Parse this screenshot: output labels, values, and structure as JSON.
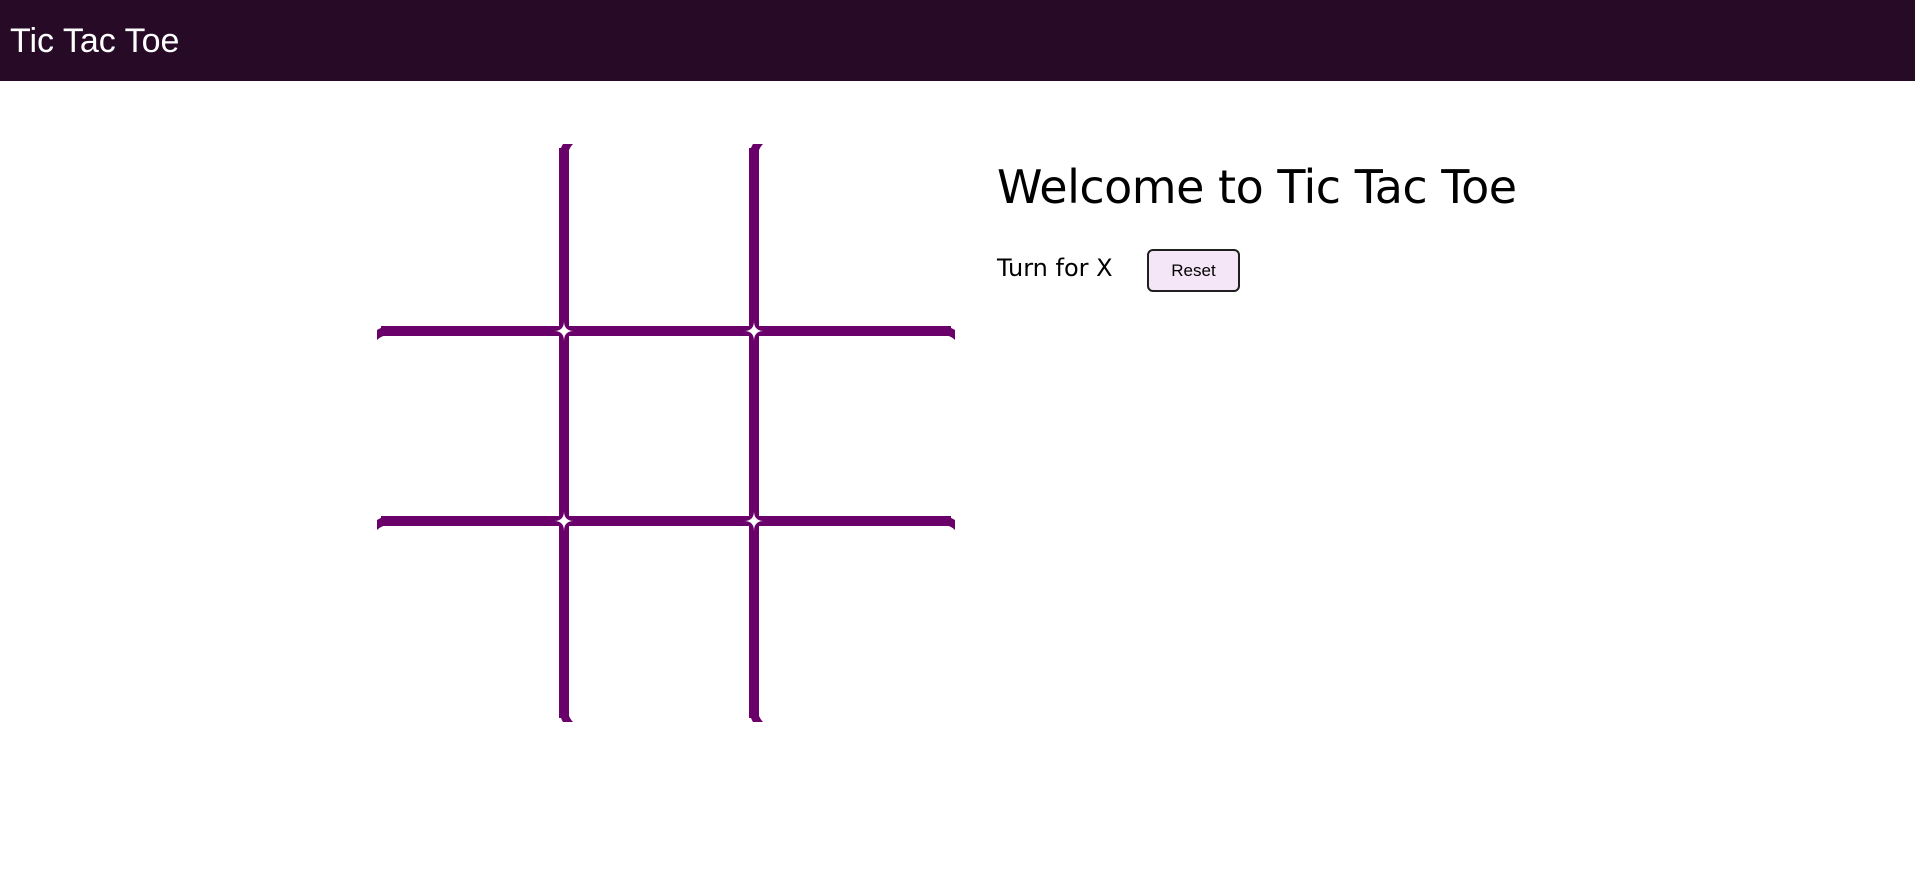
{
  "header": {
    "title": "Tic Tac Toe"
  },
  "game": {
    "heading": "Welcome to Tic Tac Toe",
    "turn_text": "Turn for X",
    "reset_label": "Reset",
    "board": [
      [
        "",
        "",
        ""
      ],
      [
        "",
        "",
        ""
      ],
      [
        "",
        "",
        ""
      ]
    ]
  },
  "colors": {
    "header_bg": "#260a26",
    "grid_line": "#6a006a",
    "reset_bg": "#f4e6f6"
  }
}
